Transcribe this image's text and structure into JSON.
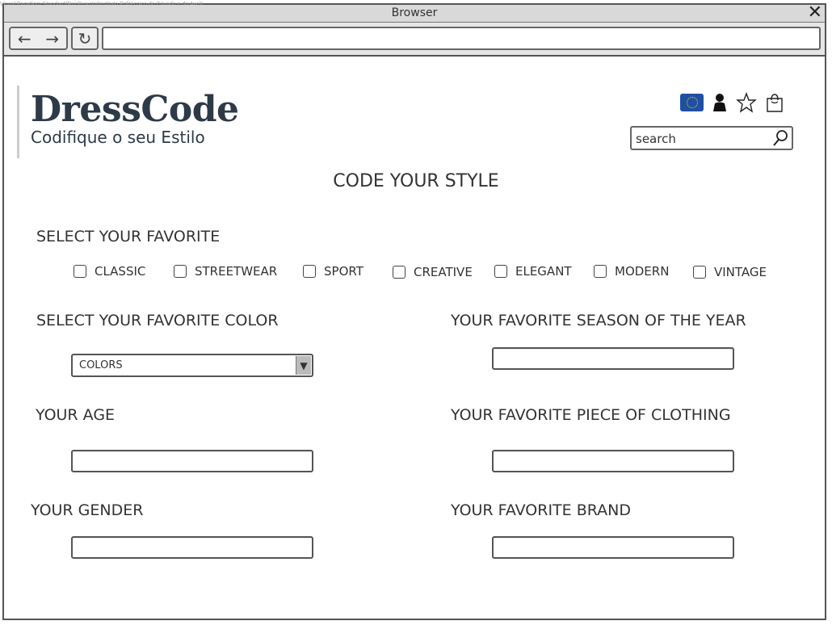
{
  "watermark": "Visual Paradigm Standard(Rui Peixoto(Instituto Politécnico do Cávado e do Ave))",
  "window": {
    "title": "Browser",
    "close_glyph": "✕"
  },
  "toolbar": {
    "back_glyph": "←",
    "forward_glyph": "→",
    "reload_glyph": "↻",
    "url": ""
  },
  "brand": {
    "name": "DressCode",
    "tagline": "Codifique o seu Estilo"
  },
  "header_icons": [
    "eu-flag-icon",
    "user-icon",
    "star-icon",
    "shopping-bag-icon"
  ],
  "search": {
    "placeholder": "search",
    "icon": "magnifier-icon"
  },
  "page": {
    "title": "CODE YOUR STYLE"
  },
  "favorite_section": {
    "label": "SELECT YOUR FAVORITE",
    "options": [
      "CLASSIC",
      "STREETWEAR",
      "SPORT",
      "CREATIVE",
      "ELEGANT",
      "MODERN",
      "VINTAGE"
    ]
  },
  "color": {
    "label": "SELECT YOUR FAVORITE COLOR",
    "selected": "COLORS"
  },
  "season": {
    "label": "YOUR FAVORITE SEASON OF THE YEAR",
    "value": ""
  },
  "age": {
    "label": "YOUR AGE",
    "value": ""
  },
  "clothing": {
    "label": "YOUR FAVORITE PIECE OF CLOTHING",
    "value": ""
  },
  "gender": {
    "label": "YOUR GENDER",
    "value": ""
  },
  "brand_fav": {
    "label": "YOUR FAVORITE BRAND",
    "value": ""
  },
  "colors": {
    "flag_blue": "#1f4fa3",
    "flag_stars": "#ffd400",
    "brand_text": "#2e3a48",
    "chrome": "#d9d9d9"
  }
}
